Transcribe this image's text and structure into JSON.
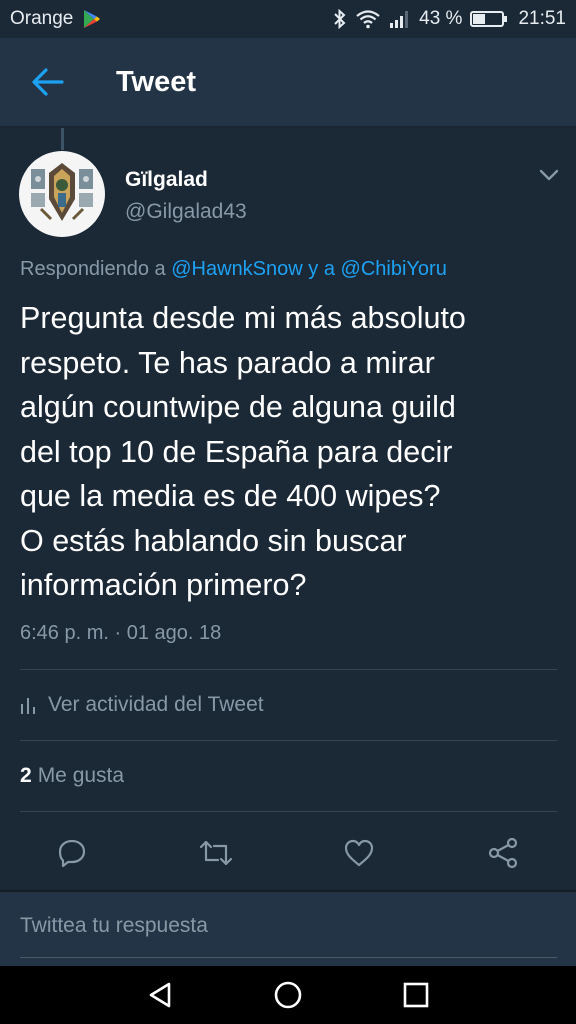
{
  "status_bar": {
    "carrier": "Orange",
    "battery_percent_text": "43 %",
    "battery_level": 0.43,
    "time": "21:51"
  },
  "header": {
    "title": "Tweet"
  },
  "tweet": {
    "display_name": "Gïlgalad",
    "handle": "@Gilgalad43",
    "replying_prefix": "Respondiendo a",
    "reply_mention_1": "@HawnkSnow",
    "reply_connector": "y a",
    "reply_mention_2": "@ChibiYoru",
    "text_lines": [
      "Pregunta desde mi más absoluto",
      "respeto. Te has parado a mirar",
      "algún countwipe de alguna guild",
      "del top 10 de España para decir",
      "que la media es de 400 wipes?",
      "O estás hablando sin buscar",
      "información primero?"
    ],
    "timestamp": "6:46 p. m. · 01 ago. 18",
    "activity_label": "Ver actividad del Tweet",
    "likes_count": "2",
    "likes_label": "Me gusta"
  },
  "reply_bar": {
    "placeholder": "Twittea tu respuesta"
  },
  "colors": {
    "background": "#1b2836",
    "header": "#243447",
    "accent": "#1da1f2",
    "secondary_text": "#8899a6",
    "divider": "#38444d"
  },
  "icons": {
    "back": "arrow-left-icon",
    "more": "chevron-down-icon",
    "reply": "comment-icon",
    "retweet": "retweet-icon",
    "like": "heart-icon",
    "share": "share-icon",
    "activity": "bar-chart-icon"
  }
}
